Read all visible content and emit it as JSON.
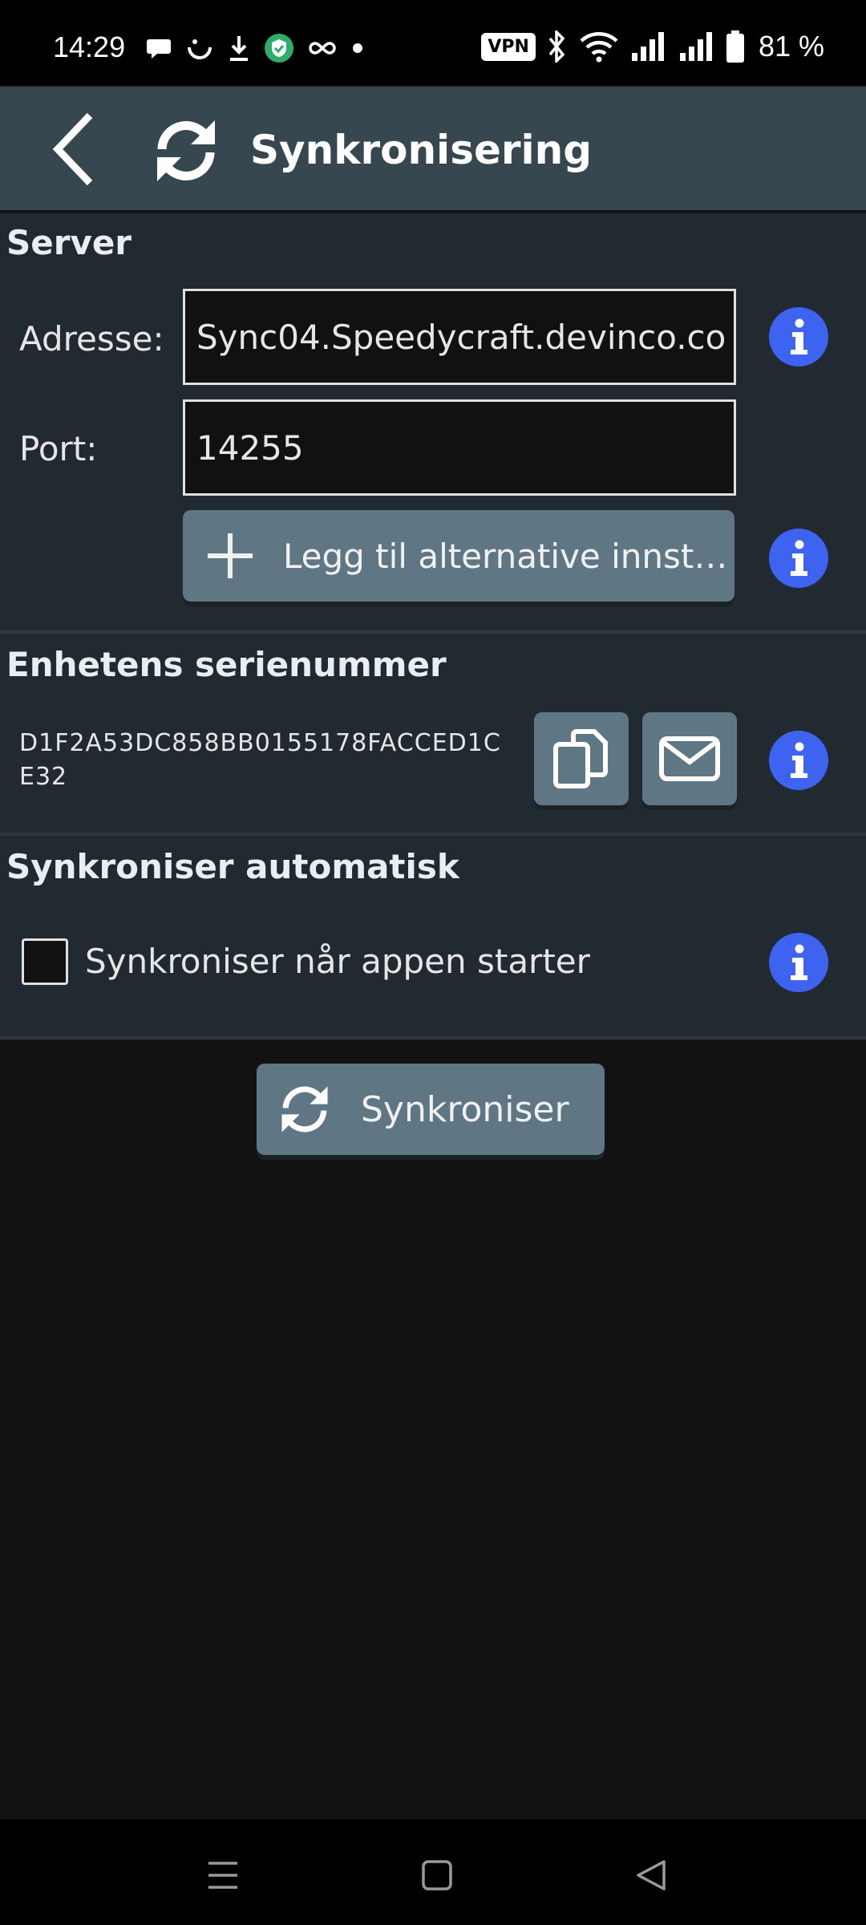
{
  "status_bar": {
    "time": "14:29",
    "vpn_label": "VPN",
    "battery_percent": "81 %",
    "left_icons": [
      "chat-bubble-icon",
      "smile-icon",
      "download-icon",
      "shield-icon",
      "infinity-icon",
      "dot-icon"
    ],
    "right_icons": [
      "vpn-icon",
      "bluetooth-icon",
      "wifi-icon",
      "signal-icon",
      "signal-icon",
      "battery-icon"
    ]
  },
  "app_bar": {
    "title": "Synkronisering",
    "back_icon": "chevron-left-icon",
    "title_icon": "sync-icon"
  },
  "server": {
    "title": "Server",
    "address_label": "Adresse:",
    "address_value": "Sync04.Speedycraft.devinco.co",
    "port_label": "Port:",
    "port_value": "14255",
    "add_alt_label": "Legg til alternative innsti…"
  },
  "serial": {
    "title": "Enhetens serienummer",
    "value": "D1F2A53DC858BB0155178FACCED1CE32"
  },
  "auto": {
    "title": "Synkroniser automatisk",
    "checkbox_label": "Synkroniser når appen starter",
    "checked": false
  },
  "sync_button": {
    "label": "Synkroniser"
  },
  "colors": {
    "app_bar": "#37474f",
    "section_bg": "#222a31",
    "button": "#5f7784",
    "info": "#3d63f0",
    "page_bg": "#121212"
  },
  "nav": {
    "items": [
      "menu-icon",
      "home-icon",
      "back-triangle-icon"
    ]
  }
}
